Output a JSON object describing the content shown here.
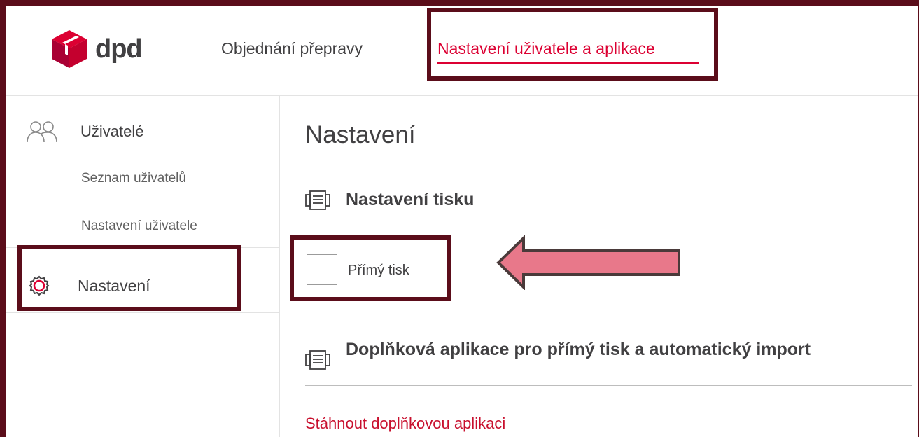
{
  "app": {
    "logo_text": "dpd",
    "brand_color": "#dc0032",
    "annotation_color": "#5b0d1a"
  },
  "nav": {
    "items": [
      {
        "label": "Objednání přepravy",
        "active": false
      },
      {
        "label": "Nastavení uživatele a aplikace",
        "active": true
      }
    ]
  },
  "sidebar": {
    "users_heading": "Uživatelé",
    "users_icon": "users-icon",
    "sub_items": [
      {
        "label": "Seznam uživatelů"
      },
      {
        "label": "Nastavení uživatele"
      }
    ],
    "settings_label": "Nastavení",
    "settings_icon": "gear-icon"
  },
  "main": {
    "title": "Nastavení",
    "print_section": {
      "title": "Nastavení tisku",
      "icon": "printer-icon"
    },
    "direct_print": {
      "label": "Přímý tisk",
      "checked": false
    },
    "addon_section": {
      "title": "Doplňková aplikace pro přímý tisk a automatický import",
      "icon": "printer-icon"
    },
    "download_link": "Stáhnout doplňkovou aplikaci"
  },
  "annotations": {
    "arrow_color": "#e8788a",
    "arrow_icon": "left-arrow-icon"
  }
}
